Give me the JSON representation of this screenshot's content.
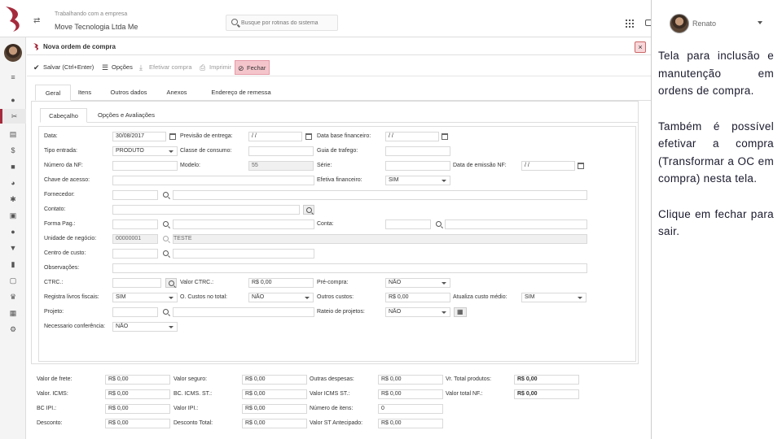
{
  "header": {
    "company_label": "Trabalhando com a empresa",
    "company_name": "Move Tecnologia Ltda Me",
    "search_placeholder": "Busque por rotinas do sistema",
    "user_name": "Renato"
  },
  "modal": {
    "title": "Nova ordem de compra",
    "close": "×"
  },
  "toolbar": {
    "save": "Salvar (Ctrl+Enter)",
    "options": "Opções",
    "efetivar": "Efetivar compra",
    "print": "Imprimir",
    "close": "Fechar"
  },
  "tabs": [
    "Geral",
    "Itens",
    "Outros dados",
    "Anexos",
    "Endereço de remessa"
  ],
  "subtabs": [
    "Cabeçalho",
    "Opções e Avaliações"
  ],
  "form": {
    "data_label": "Data:",
    "data_value": "30/08/2017",
    "previsao_label": "Previsão de entrega:",
    "previsao_value": "/ /",
    "database_label": "Data base financeiro:",
    "database_value": "/ /",
    "tipo_label": "Tipo entrada:",
    "tipo_value": "PRODUTO",
    "classe_label": "Classe de consumo:",
    "guia_label": "Guia de trafego:",
    "nf_label": "Número da NF:",
    "modelo_label": "Modelo:",
    "modelo_value": "55",
    "serie_label": "Série:",
    "emissao_label": "Data de emissão NF:",
    "emissao_value": "/ /",
    "chave_label": "Chave de acesso:",
    "efetiva_label": "Efetiva financeiro:",
    "efetiva_value": "SIM",
    "fornecedor_label": "Fornecedor:",
    "contato_label": "Contato:",
    "forma_label": "Forma Pag.:",
    "conta_label": "Conta:",
    "unidade_label": "Unidade de negócio:",
    "unidade_code": "00000001",
    "unidade_name": "TESTE",
    "centro_label": "Centro de custo:",
    "obs_label": "Observações:",
    "ctrc_label": "CTRC.:",
    "valor_ctrc_label": "Valor CTRC.:",
    "valor_ctrc_value": "R$ 0,00",
    "precompra_label": "Pré-compra:",
    "precompra_value": "NÃO",
    "registra_label": "Registra livros fiscais:",
    "registra_value": "SIM",
    "ocustos_label": "O. Custos no total:",
    "ocustos_value": "NÃO",
    "outros_label": "Outros custos:",
    "outros_value": "R$ 0,00",
    "atualiza_label": "Atualiza custo médio:",
    "atualiza_value": "SIM",
    "projeto_label": "Projeto:",
    "rateio_label": "Rateio de projetos:",
    "rateio_value": "NÃO",
    "conferencia_label": "Necessario conferência:",
    "conferencia_value": "NÃO"
  },
  "footer": {
    "frete_label": "Valor de frete:",
    "frete": "R$ 0,00",
    "seguro_label": "Valor seguro:",
    "seguro": "R$ 0,00",
    "despesas_label": "Outras despesas:",
    "despesas": "R$ 0,00",
    "totprod_label": "Vr. Total produtos:",
    "totprod": "R$ 0,00",
    "icms_label": "Valor. ICMS:",
    "icms": "R$ 0,00",
    "bcst_label": "BC. ICMS. ST.:",
    "bcst": "R$ 0,00",
    "icmsst_label": "Valor ICMS ST.:",
    "icmsst": "R$ 0,00",
    "totnf_label": "Valor total NF.:",
    "totnf": "R$ 0,00",
    "bcipi_label": "BC IPI.:",
    "bcipi": "R$ 0,00",
    "ipi_label": "Valor IPI.:",
    "ipi": "R$ 0,00",
    "itens_label": "Número de itens:",
    "itens": "0",
    "desc_label": "Desconto:",
    "desc": "R$ 0,00",
    "desctot_label": "Desconto Total:",
    "desctot": "R$ 0,00",
    "stant_label": "Valor ST Antecipado:",
    "stant": "R$ 0,00"
  },
  "side_text": [
    "Tela para inclusão e manutenção em ordens de compra.",
    "Também é possível efetivar a compra (Transformar a OC em compra) nesta tela.",
    "Clique em fechar para sair."
  ],
  "colors": {
    "brand": "#a52a3c",
    "text": "#1a1a2e"
  }
}
